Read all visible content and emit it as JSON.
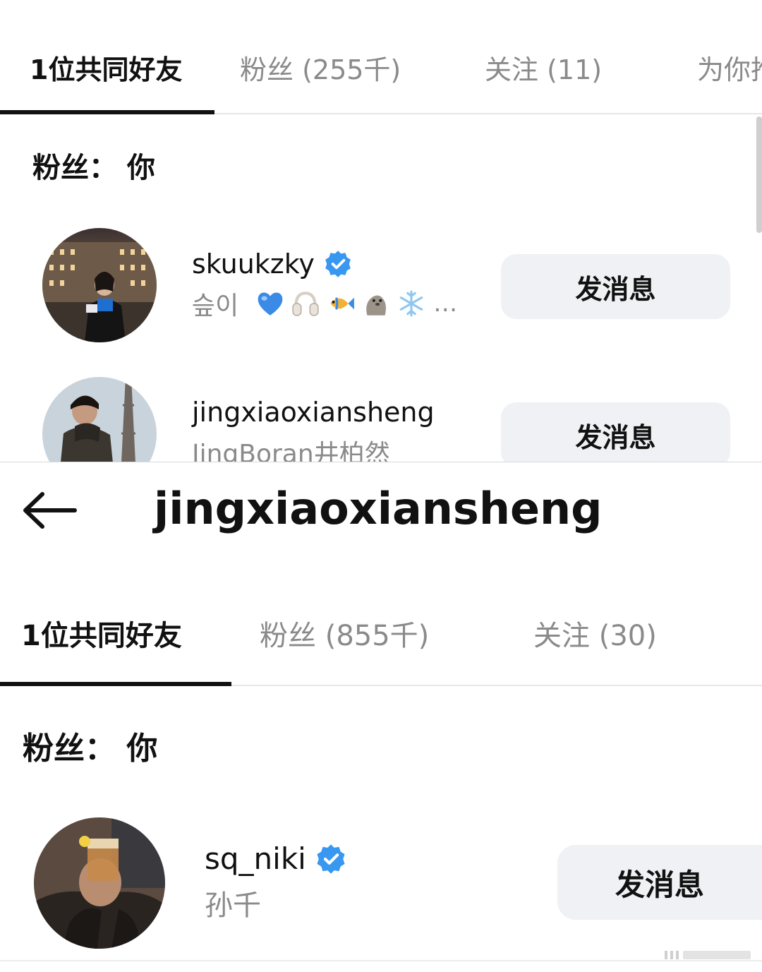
{
  "top_panel": {
    "tabs": [
      {
        "label": "1位共同好友",
        "active": true
      },
      {
        "label": "粉丝 (255千)",
        "active": false
      },
      {
        "label": "关注 (11)",
        "active": false
      },
      {
        "label": "为你推",
        "active": false
      }
    ],
    "section_label": "粉丝： 你",
    "users": [
      {
        "username": "skuukzky",
        "verified": true,
        "subtitle": "슾이",
        "emojis": [
          "blue-heart",
          "headphones",
          "tropical-fish",
          "seal",
          "snowflake"
        ],
        "subtitle_overflow": "…",
        "button_label": "发消息"
      },
      {
        "username": "jingxiaoxiansheng",
        "verified": false,
        "subtitle": "JingBoran井柏然",
        "button_label": "发消息"
      }
    ]
  },
  "bottom_panel": {
    "header_title": "jingxiaoxiansheng",
    "tabs": [
      {
        "label": "1位共同好友",
        "active": true
      },
      {
        "label": "粉丝 (855千)",
        "active": false
      },
      {
        "label": "关注 (30)",
        "active": false
      }
    ],
    "section_label": "粉丝： 你",
    "users": [
      {
        "username": "sq_niki",
        "verified": true,
        "subtitle": "孙千",
        "button_label": "发消息"
      }
    ]
  },
  "colors": {
    "verified_blue": "#3897f0",
    "button_bg": "#eff1f4",
    "muted_text": "#8a8a8a",
    "tab_indicator": "#111111"
  }
}
